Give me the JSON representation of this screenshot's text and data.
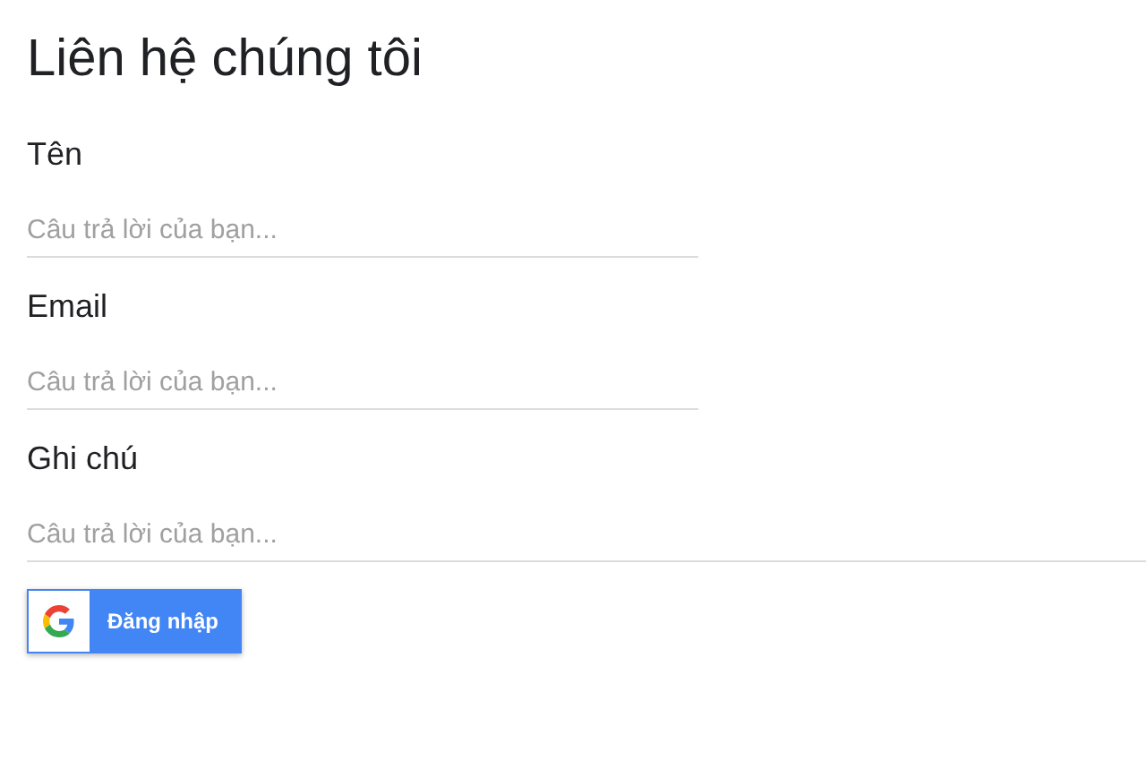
{
  "title": "Liên hệ chúng tôi",
  "fields": [
    {
      "label": "Tên",
      "placeholder": "Câu trả lời của bạn...",
      "kind": "short"
    },
    {
      "label": "Email",
      "placeholder": "Câu trả lời của bạn...",
      "kind": "short"
    },
    {
      "label": "Ghi chú",
      "placeholder": "Câu trả lời của bạn...",
      "kind": "long"
    }
  ],
  "signin_button": "Đăng nhập"
}
